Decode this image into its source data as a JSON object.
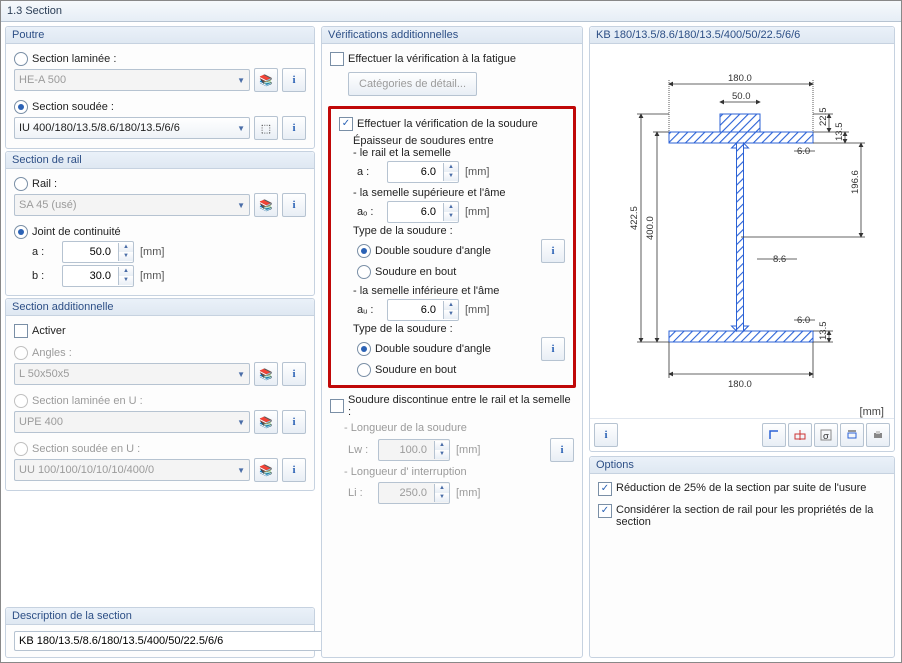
{
  "window": {
    "title": "1.3 Section"
  },
  "poutre": {
    "title": "Poutre",
    "rolled_label": "Section laminée :",
    "rolled_value": "HE-A 500",
    "welded_label": "Section soudée :",
    "welded_value": "IU 400/180/13.5/8.6/180/13.5/6/6"
  },
  "rail": {
    "title": "Section de rail",
    "rail_label": "Rail :",
    "rail_value": "SA 45 (usé)",
    "joint_label": "Joint de continuité",
    "a_label": "a :",
    "a_value": "50.0",
    "b_label": "b :",
    "b_value": "30.0",
    "unit": "[mm]"
  },
  "additional": {
    "title": "Section additionnelle",
    "activate_label": "Activer",
    "angle_label": "Angles :",
    "angle_value": "L 50x50x5",
    "u_rolled_label": "Section laminée en U :",
    "u_rolled_value": "UPE 400",
    "u_welded_label": "Section soudée en U :",
    "u_welded_value": "UU 100/100/10/10/10/400/0"
  },
  "description": {
    "title": "Description de la section",
    "value": "KB 180/13.5/8.6/180/13.5/400/50/22.5/6/6"
  },
  "verif": {
    "title": "Vérifications additionnelles",
    "fatigue_label": "Effectuer la vérification à la fatigue",
    "fatigue_btn": "Catégories de détail...",
    "weld_label": "Effectuer la vérification de la soudure",
    "thickness_hdr": "Épaisseur de soudures entre",
    "rail_flange": "- le rail et la semelle",
    "a_label": "a :",
    "a_value": "6.0",
    "top_flange_web": "- la semelle supérieure et l'âme",
    "ao_label": "aₒ :",
    "ao_value": "6.0",
    "weld_type_label": "Type de la soudure :",
    "opt_double": "Double soudure d'angle",
    "opt_butt": "Soudure en bout",
    "bot_flange_web": "- la semelle inférieure et l'âme",
    "au_label": "aᵤ :",
    "au_value": "6.0",
    "unit": "[mm]",
    "discont_label": "Soudure discontinue entre le rail et la semelle :",
    "lw_hdr": "- Longueur de la soudure",
    "lw_label": "Lw :",
    "lw_value": "100.0",
    "li_hdr": "- Longueur d' interruption",
    "li_label": "Li :",
    "li_value": "250.0"
  },
  "preview": {
    "title": "KB 180/13.5/8.6/180/13.5/400/50/22.5/6/6",
    "unit": "[mm]",
    "dims": {
      "b_top": "180.0",
      "b_bot": "180.0",
      "rail_w": "50.0",
      "rail_h": "22.5",
      "tf": "13.5",
      "h": "400.0",
      "H": "422.5",
      "inner": "196.6",
      "tw": "8.6",
      "a": "6.0"
    }
  },
  "options": {
    "title": "Options",
    "reduction": "Réduction de 25% de la section par suite de l'usure",
    "consider": "Considérer la section de rail pour les propriétés de la section"
  }
}
